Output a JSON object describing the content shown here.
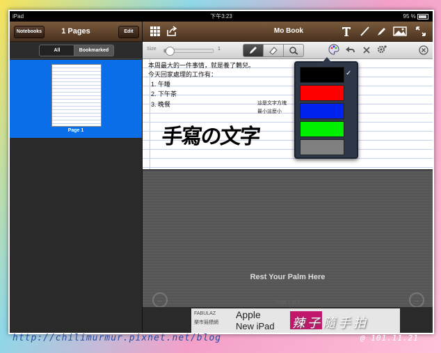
{
  "status": {
    "device": "iPad",
    "time": "下午3:23",
    "battery": "95 %"
  },
  "left_panel": {
    "notebooks_label": "Notebooks",
    "title": "1 Pages",
    "edit_label": "Edit",
    "filter_all": "All",
    "filter_bookmarked": "Bookmarked",
    "page_label": "Page 1"
  },
  "main": {
    "title": "Mo Book",
    "size_label": "Size",
    "size_value": "1",
    "size_fraction": 0.05
  },
  "note": {
    "lines": [
      "本周最大的一件事情，就是養了鶇兒。",
      "今天回家處理的工作有："
    ],
    "list": [
      "1. 午睡",
      "2. 下午茶",
      "3. 晚餐"
    ],
    "small_lines": [
      "這是文字方塊",
      "最小這麼小"
    ],
    "handwriting": "手寫の文字"
  },
  "palm": {
    "text": "Rest Your Palm Here",
    "page_indicator": "Page 1 of 1"
  },
  "ad": {
    "brand": "FABULAZ",
    "sub": "樂市競標網",
    "line1": "Apple",
    "line2": "New iPad"
  },
  "colors": {
    "options": [
      "#000000",
      "#ff0000",
      "#0022ee",
      "#00ee00",
      "#808080"
    ],
    "selected_index": 0,
    "check": "✓"
  },
  "watermark": {
    "url": "http://chilimurmur.pixnet.net/blog",
    "signature": "辣子隨手拍",
    "date": "@ 101.11.21"
  }
}
